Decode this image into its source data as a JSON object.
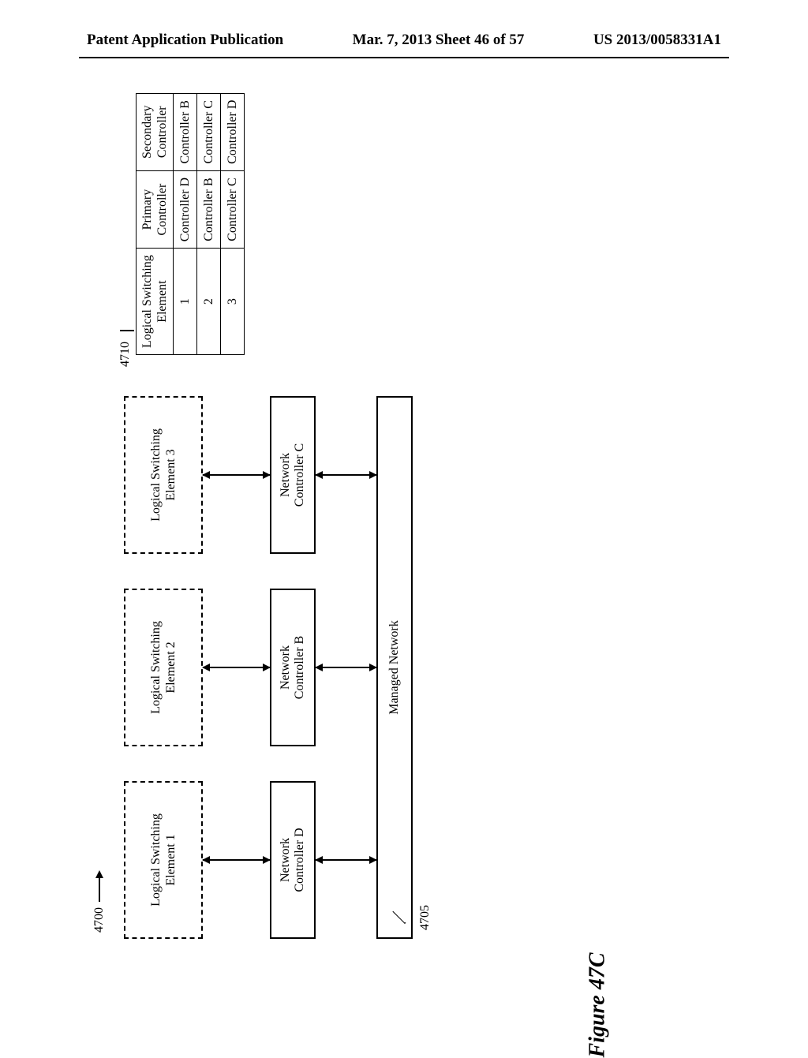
{
  "header": {
    "left": "Patent Application Publication",
    "center": "Mar. 7, 2013  Sheet 46 of 57",
    "right": "US 2013/0058331A1"
  },
  "refs": {
    "main": "4700",
    "network": "4705",
    "table": "4710"
  },
  "lse": [
    {
      "line1": "Logical Switching",
      "line2": "Element 1"
    },
    {
      "line1": "Logical Switching",
      "line2": "Element 2"
    },
    {
      "line1": "Logical Switching",
      "line2": "Element 3"
    }
  ],
  "controllers": [
    {
      "line1": "Network",
      "line2": "Controller D"
    },
    {
      "line1": "Network",
      "line2": "Controller B"
    },
    {
      "line1": "Network",
      "line2": "Controller C"
    }
  ],
  "managed_network": "Managed Network",
  "table": {
    "headers": {
      "c1l1": "Logical Switching",
      "c1l2": "Element",
      "c2l1": "Primary",
      "c2l2": "Controller",
      "c3l1": "Secondary",
      "c3l2": "Controller"
    },
    "rows": [
      {
        "lse": "1",
        "primary": "Controller D",
        "secondary": "Controller B"
      },
      {
        "lse": "2",
        "primary": "Controller B",
        "secondary": "Controller C"
      },
      {
        "lse": "3",
        "primary": "Controller C",
        "secondary": "Controller D"
      }
    ]
  },
  "figure_label": "Figure 47C"
}
